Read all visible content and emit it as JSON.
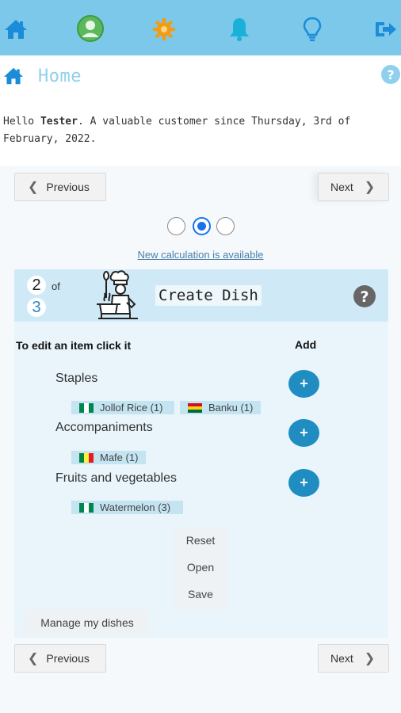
{
  "nav": {
    "icons": [
      "home-icon",
      "profile-icon",
      "settings-icon",
      "notifications-icon",
      "tips-icon",
      "logout-icon"
    ]
  },
  "header": {
    "title": "Home"
  },
  "greeting": {
    "hello": "Hello",
    "name": "Tester",
    "rest": ". A valuable customer since Thursday, 3rd of February, 2022."
  },
  "pager": {
    "previous": "Previous",
    "next": "Next"
  },
  "steps": {
    "selected_index": 2,
    "count": 3
  },
  "calc_link": "New calculation is available",
  "panel": {
    "step_current": "2",
    "step_of": "of",
    "step_total": "3",
    "title": "Create Dish",
    "edit_hint": "To edit an item click it",
    "add_label": "Add",
    "add_symbol": "+",
    "categories": [
      {
        "name": "Staples",
        "items": [
          {
            "label": "Jollof Rice (1)",
            "flag": "nigeria"
          },
          {
            "label": "Banku (1)",
            "flag": "ghana"
          }
        ]
      },
      {
        "name": "Accompaniments",
        "items": [
          {
            "label": "Mafe (1)",
            "flag": "senegal"
          }
        ]
      },
      {
        "name": "Fruits and vegetables",
        "items": [
          {
            "label": "Watermelon (3)",
            "flag": "nigeria"
          }
        ]
      }
    ],
    "actions": {
      "reset": "Reset",
      "open": "Open",
      "save": "Save"
    },
    "manage": "Manage my dishes"
  },
  "colors": {
    "topbar": "#7cc8ea",
    "home": "#1a8cd8",
    "profile": "#5cb85c",
    "settings": "#f39c12",
    "bell": "#1ab0d8",
    "accent": "#1f8dc2"
  }
}
